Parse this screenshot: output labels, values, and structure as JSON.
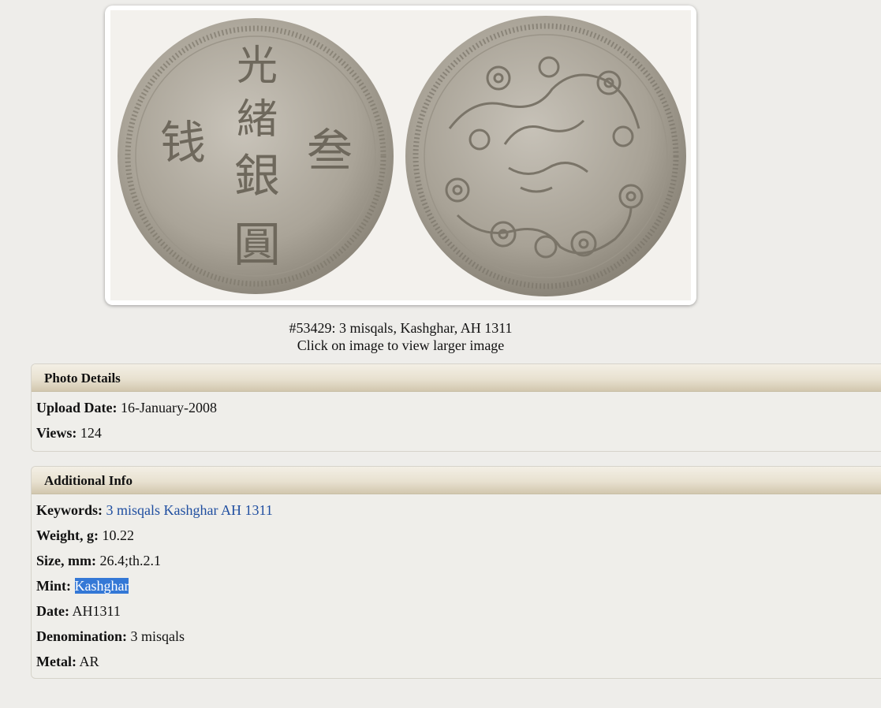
{
  "photo": {
    "caption": "#53429: 3 misqals, Kashghar, AH 1311",
    "hint": "Click on image to view larger image",
    "obverse_chars": [
      "光",
      "緒",
      "銀",
      "圓",
      "钱",
      "叁"
    ]
  },
  "photo_details": {
    "title": "Photo Details",
    "rows": [
      {
        "label": "Upload Date:",
        "value": "16-January-2008"
      },
      {
        "label": "Views:",
        "value": "124"
      }
    ]
  },
  "additional_info": {
    "title": "Additional Info",
    "keywords": {
      "label": "Keywords:",
      "value": "3 misqals Kashghar AH 1311"
    },
    "weight": {
      "label": "Weight, g:",
      "value": "10.22"
    },
    "size": {
      "label": "Size, mm:",
      "value": "26.4;th.2.1"
    },
    "mint": {
      "label": "Mint:",
      "value": "Kashghar"
    },
    "date": {
      "label": "Date:",
      "value": "AH1311"
    },
    "denomination": {
      "label": "Denomination:",
      "value": "3 misqals"
    },
    "metal": {
      "label": "Metal:",
      "value": "AR"
    }
  },
  "colors": {
    "page_bg": "#eeedea",
    "link": "#1f4ea0",
    "selection": "#3478d6",
    "coin_silver": "#b3ada1"
  }
}
